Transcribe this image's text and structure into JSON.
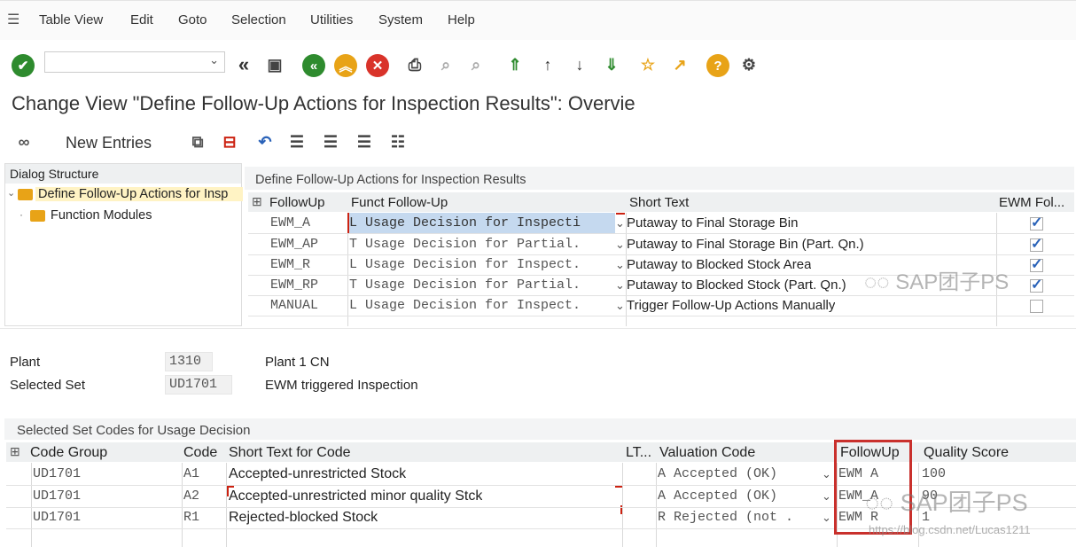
{
  "menu": {
    "items": [
      "Table View",
      "Edit",
      "Goto",
      "Selection",
      "Utilities",
      "System",
      "Help"
    ]
  },
  "toolbar": {
    "command_field_value": ""
  },
  "page_title": "Change View \"Define Follow-Up Actions for Inspection Results\": Overvie",
  "app_toolbar": {
    "new_entries_label": "New Entries"
  },
  "dialog_structure": {
    "header": "Dialog Structure",
    "items": [
      {
        "label": "Define Follow-Up Actions for Insp",
        "selected": true
      },
      {
        "label": "Function Modules",
        "selected": false
      }
    ]
  },
  "top_table": {
    "title": "Define Follow-Up Actions for Inspection Results",
    "columns": [
      "FollowUp",
      "Funct Follow-Up",
      "Short Text",
      "EWM Fol..."
    ],
    "rows": [
      {
        "followup": "EWM_A",
        "funct": "L Usage Decision for Inspecti",
        "short": "Putaway to Final Storage Bin",
        "ewm": true
      },
      {
        "followup": "EWM_AP",
        "funct": "T Usage Decision for Partial.",
        "short": "Putaway to Final Storage Bin (Part. Qn.)",
        "ewm": true
      },
      {
        "followup": "EWM_R",
        "funct": "L Usage Decision for Inspect.",
        "short": "Putaway to Blocked Stock Area",
        "ewm": true
      },
      {
        "followup": "EWM_RP",
        "funct": "T Usage Decision for Partial.",
        "short": "Putaway to Blocked Stock (Part. Qn.)",
        "ewm": true
      },
      {
        "followup": "MANUAL",
        "funct": "L Usage Decision for Inspect.",
        "short": "Trigger Follow-Up Actions Manually",
        "ewm": false
      }
    ]
  },
  "form": {
    "plant_label": "Plant",
    "plant_value": "1310",
    "plant_desc": "Plant 1 CN",
    "set_label": "Selected Set",
    "set_value": "UD1701",
    "set_desc": "EWM triggered Inspection"
  },
  "bottom_table": {
    "title": "Selected Set Codes for Usage Decision",
    "columns": [
      "Code Group",
      "Code",
      "Short Text for Code",
      "LT...",
      "Valuation Code",
      "FollowUp",
      "Quality Score"
    ],
    "rows": [
      {
        "group": "UD1701",
        "code": "A1",
        "text": "Accepted-unrestricted Stock",
        "valuation": "A Accepted (OK)",
        "followup": "EWM A",
        "score": "100"
      },
      {
        "group": "UD1701",
        "code": "A2",
        "text": "Accepted-unrestricted minor quality Stck",
        "valuation": "A Accepted (OK)",
        "followup": "EWM_A",
        "score": "90"
      },
      {
        "group": "UD1701",
        "code": "R1",
        "text": "Rejected-blocked Stock",
        "valuation": "R Rejected (not .",
        "followup": "EWM R",
        "score": "1"
      }
    ]
  },
  "watermark": {
    "text": "SAP团子PS",
    "url": "https://blog.csdn.net/Lucas1211"
  },
  "colors": {
    "green": "#2e8b2e",
    "orange": "#e8a317",
    "red": "#d9332a",
    "highlight": "#c9302c",
    "selection_blue": "#c5d9ef"
  }
}
